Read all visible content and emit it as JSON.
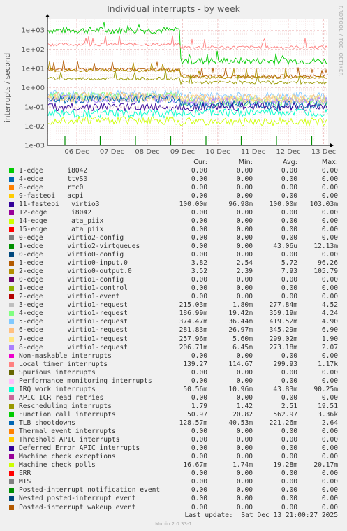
{
  "chart_data": {
    "type": "line",
    "title": "Individual interrupts - by week",
    "ylabel": "interrupts / second",
    "side_label": "RRDTOOL / TOBI OETIKER",
    "y_scale": "log",
    "ylim": [
      0.001,
      2000
    ],
    "y_ticks": [
      "1e-03",
      "1e-02",
      "1e-01",
      "1e+00",
      "1e+01",
      "1e+02",
      "1e+03"
    ],
    "x_ticks": [
      "06 Dec",
      "07 Dec",
      "08 Dec",
      "09 Dec",
      "10 Dec",
      "11 Dec",
      "12 Dec",
      "13 Dec"
    ],
    "grid": true,
    "legend_placement": "bottom",
    "headers": [
      "Cur:",
      "Min:",
      "Avg:",
      "Max:"
    ],
    "series": [
      {
        "name": "1-edge      i8042",
        "color": "#00cc00",
        "cur": "0.00",
        "min": "0.00",
        "avg": "0.00",
        "max": "0.00"
      },
      {
        "name": "4-edge      ttyS0",
        "color": "#0066b3",
        "cur": "0.00",
        "min": "0.00",
        "avg": "0.00",
        "max": "0.00"
      },
      {
        "name": "8-edge      rtc0",
        "color": "#ff8000",
        "cur": "0.00",
        "min": "0.00",
        "avg": "0.00",
        "max": "0.00"
      },
      {
        "name": "9-fasteoi   acpi",
        "color": "#ffcc00",
        "cur": "0.00",
        "min": "0.00",
        "avg": "0.00",
        "max": "0.00"
      },
      {
        "name": "11-fasteoi   virtio3",
        "color": "#330099",
        "cur": "100.00m",
        "min": "96.98m",
        "avg": "100.00m",
        "max": "103.03m"
      },
      {
        "name": "12-edge      i8042",
        "color": "#990099",
        "cur": "0.00",
        "min": "0.00",
        "avg": "0.00",
        "max": "0.00"
      },
      {
        "name": "14-edge      ata_piix",
        "color": "#ccff00",
        "cur": "0.00",
        "min": "0.00",
        "avg": "0.00",
        "max": "0.00"
      },
      {
        "name": "15-edge      ata_piix",
        "color": "#ff0000",
        "cur": "0.00",
        "min": "0.00",
        "avg": "0.00",
        "max": "0.00"
      },
      {
        "name": "0-edge      virtio2-config",
        "color": "#808080",
        "cur": "0.00",
        "min": "0.00",
        "avg": "0.00",
        "max": "0.00"
      },
      {
        "name": "1-edge      virtio2-virtqueues",
        "color": "#008f00",
        "cur": "0.00",
        "min": "0.00",
        "avg": "43.06u",
        "max": "12.13m"
      },
      {
        "name": "0-edge      virtio0-config",
        "color": "#00487d",
        "cur": "0.00",
        "min": "0.00",
        "avg": "0.00",
        "max": "0.00"
      },
      {
        "name": "1-edge      virtio0-input.0",
        "color": "#b35a00",
        "cur": "3.82",
        "min": "2.54",
        "avg": "5.72",
        "max": "96.26"
      },
      {
        "name": "2-edge      virtio0-output.0",
        "color": "#b38f00",
        "cur": "3.52",
        "min": "2.39",
        "avg": "7.93",
        "max": "105.79"
      },
      {
        "name": "0-edge      virtio1-config",
        "color": "#6b006b",
        "cur": "0.00",
        "min": "0.00",
        "avg": "0.00",
        "max": "0.00"
      },
      {
        "name": "1-edge      virtio1-control",
        "color": "#8fb300",
        "cur": "0.00",
        "min": "0.00",
        "avg": "0.00",
        "max": "0.00"
      },
      {
        "name": "2-edge      virtio1-event",
        "color": "#b30000",
        "cur": "0.00",
        "min": "0.00",
        "avg": "0.00",
        "max": "0.00"
      },
      {
        "name": "3-edge      virtio1-request",
        "color": "#bebebe",
        "cur": "215.03m",
        "min": "1.80m",
        "avg": "277.84m",
        "max": "4.52"
      },
      {
        "name": "4-edge      virtio1-request",
        "color": "#80ff80",
        "cur": "186.99m",
        "min": "19.42m",
        "avg": "359.19m",
        "max": "4.24"
      },
      {
        "name": "5-edge      virtio1-request",
        "color": "#80c9ff",
        "cur": "374.47m",
        "min": "36.44m",
        "avg": "419.52m",
        "max": "4.90"
      },
      {
        "name": "6-edge      virtio1-request",
        "color": "#ffc080",
        "cur": "281.83m",
        "min": "26.97m",
        "avg": "345.29m",
        "max": "6.90"
      },
      {
        "name": "7-edge      virtio1-request",
        "color": "#ffe680",
        "cur": "257.96m",
        "min": "5.60m",
        "avg": "299.02m",
        "max": "1.90"
      },
      {
        "name": "8-edge      virtio1-request",
        "color": "#aa80ff",
        "cur": "206.71m",
        "min": "6.45m",
        "avg": "273.18m",
        "max": "2.07"
      },
      {
        "name": "Non-maskable interrupts",
        "color": "#ee00cc",
        "cur": "0.00",
        "min": "0.00",
        "avg": "0.00",
        "max": "0.00"
      },
      {
        "name": "Local timer interrupts",
        "color": "#ff8080",
        "cur": "139.27",
        "min": "114.67",
        "avg": "299.93",
        "max": "1.17k"
      },
      {
        "name": "Spurious interrupts",
        "color": "#666600",
        "cur": "0.00",
        "min": "0.00",
        "avg": "0.00",
        "max": "0.00"
      },
      {
        "name": "Performance monitoring interrupts",
        "color": "#ffbfff",
        "cur": "0.00",
        "min": "0.00",
        "avg": "0.00",
        "max": "0.00"
      },
      {
        "name": "IRQ work interrupts",
        "color": "#00ffcc",
        "cur": "50.56m",
        "min": "10.96m",
        "avg": "43.83m",
        "max": "90.25m"
      },
      {
        "name": "APIC ICR read retries",
        "color": "#cc6699",
        "cur": "0.00",
        "min": "0.00",
        "avg": "0.00",
        "max": "0.00"
      },
      {
        "name": "Rescheduling interrupts",
        "color": "#999900",
        "cur": "1.79",
        "min": "1.42",
        "avg": "2.51",
        "max": "19.51"
      },
      {
        "name": "Function call interrupts",
        "color": "#00cc00",
        "cur": "50.97",
        "min": "20.82",
        "avg": "562.97",
        "max": "3.36k"
      },
      {
        "name": "TLB shootdowns",
        "color": "#0066b3",
        "cur": "128.57m",
        "min": "40.53m",
        "avg": "221.26m",
        "max": "2.64"
      },
      {
        "name": "Thermal event interrupts",
        "color": "#ff8000",
        "cur": "0.00",
        "min": "0.00",
        "avg": "0.00",
        "max": "0.00"
      },
      {
        "name": "Threshold APIC interrupts",
        "color": "#ffcc00",
        "cur": "0.00",
        "min": "0.00",
        "avg": "0.00",
        "max": "0.00"
      },
      {
        "name": "Deferred Error APIC interrupts",
        "color": "#330099",
        "cur": "0.00",
        "min": "0.00",
        "avg": "0.00",
        "max": "0.00"
      },
      {
        "name": "Machine check exceptions",
        "color": "#990099",
        "cur": "0.00",
        "min": "0.00",
        "avg": "0.00",
        "max": "0.00"
      },
      {
        "name": "Machine check polls",
        "color": "#ccff00",
        "cur": "16.67m",
        "min": "1.74m",
        "avg": "19.28m",
        "max": "20.17m"
      },
      {
        "name": "ERR",
        "color": "#ff0000",
        "cur": "0.00",
        "min": "0.00",
        "avg": "0.00",
        "max": "0.00"
      },
      {
        "name": "MIS",
        "color": "#808080",
        "cur": "0.00",
        "min": "0.00",
        "avg": "0.00",
        "max": "0.00"
      },
      {
        "name": "Posted-interrupt notification event",
        "color": "#008f00",
        "cur": "0.00",
        "min": "0.00",
        "avg": "0.00",
        "max": "0.00"
      },
      {
        "name": "Nested posted-interrupt event",
        "color": "#00487d",
        "cur": "0.00",
        "min": "0.00",
        "avg": "0.00",
        "max": "0.00"
      },
      {
        "name": "Posted-interrupt wakeup event",
        "color": "#b35a00",
        "cur": "0.00",
        "min": "0.00",
        "avg": "0.00",
        "max": "0.00"
      }
    ],
    "plotted_levels": [
      {
        "name": "Function call interrupts",
        "before": 1000,
        "after": 25,
        "color": "#00cc00"
      },
      {
        "name": "Local timer interrupts",
        "before": 180,
        "after": 130,
        "color": "#ff8080"
      },
      {
        "name": "1-edge      virtio0-input.0",
        "before": 9,
        "after": 4,
        "color": "#b35a00"
      },
      {
        "name": "2-edge      virtio0-output.0",
        "before": 8,
        "after": 3.5,
        "color": "#b38f00"
      },
      {
        "name": "Rescheduling interrupts",
        "before": 3,
        "after": 1.9,
        "color": "#999900"
      },
      {
        "name": "5-edge      virtio1-request",
        "before": 0.45,
        "after": 0.37,
        "color": "#80c9ff"
      },
      {
        "name": "6-edge      virtio1-request",
        "before": 0.38,
        "after": 0.28,
        "color": "#ffc080"
      },
      {
        "name": "4-edge      virtio1-request",
        "before": 0.36,
        "after": 0.19,
        "color": "#80ff80"
      },
      {
        "name": "3-edge      virtio1-request",
        "before": 0.3,
        "after": 0.21,
        "color": "#bebebe"
      },
      {
        "name": "8-edge      virtio1-request",
        "before": 0.28,
        "after": 0.2,
        "color": "#aa80ff"
      },
      {
        "name": "7-edge      virtio1-request",
        "before": 0.3,
        "after": 0.26,
        "color": "#ffe680"
      },
      {
        "name": "TLB shootdowns",
        "before": 0.25,
        "after": 0.13,
        "color": "#0066b3"
      },
      {
        "name": "11-fasteoi   virtio3",
        "before": 0.1,
        "after": 0.1,
        "color": "#330099"
      },
      {
        "name": "IRQ work interrupts",
        "before": 0.045,
        "after": 0.05,
        "color": "#00ffcc"
      },
      {
        "name": "Machine check polls",
        "before": 0.0195,
        "after": 0.0167,
        "color": "#ccff00"
      }
    ]
  },
  "footer": {
    "last_update": "Last update:  Sat Dec 13 21:00:27 2025",
    "munin": "Munin 2.0.33-1"
  }
}
